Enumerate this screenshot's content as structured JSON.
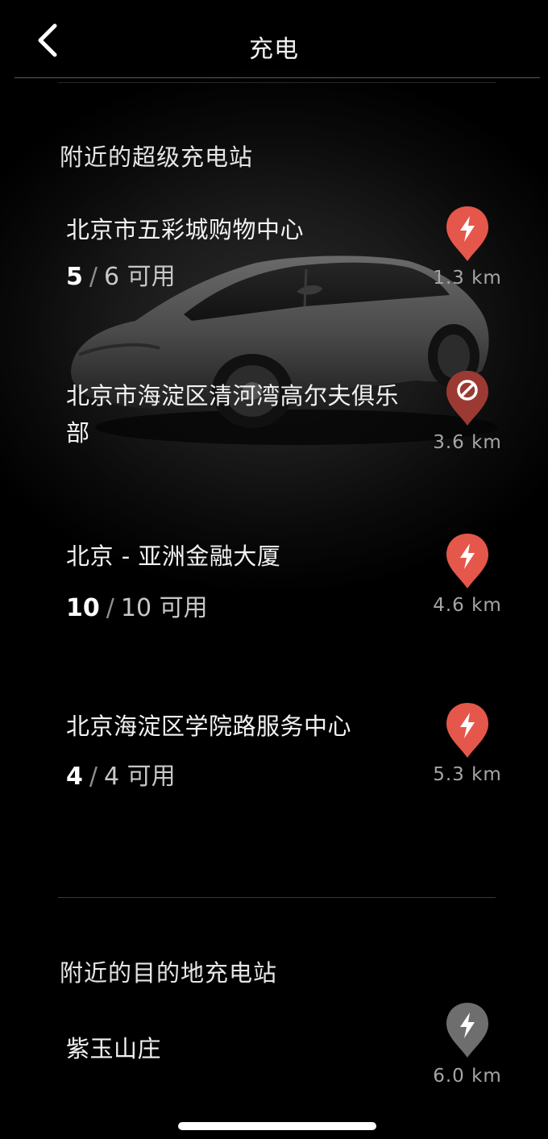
{
  "header": {
    "title": "充电",
    "back_icon": "chevron-left-icon"
  },
  "superchargers": {
    "title": "附近的超级充电站",
    "stations": [
      {
        "name": "北京市五彩城购物中心",
        "available": "5",
        "separator": "/",
        "total": "6",
        "unit": "可用",
        "distance": "1.3 km",
        "status": "available",
        "icon": "bolt-pin-icon",
        "color": "#e5574a"
      },
      {
        "name": "北京市海淀区清河湾高尔夫俱乐部",
        "distance": "3.6 km",
        "status": "unavailable",
        "icon": "no-entry-pin-icon",
        "color": "#9b3a33"
      },
      {
        "name": "北京 - 亚洲金融大厦",
        "available": "10",
        "separator": "/",
        "total": "10",
        "unit": "可用",
        "distance": "4.6 km",
        "status": "available",
        "icon": "bolt-pin-icon",
        "color": "#e5574a"
      },
      {
        "name": "北京海淀区学院路服务中心",
        "available": "4",
        "separator": "/",
        "total": "4",
        "unit": "可用",
        "distance": "5.3 km",
        "status": "available",
        "icon": "bolt-pin-icon",
        "color": "#e5574a"
      }
    ]
  },
  "destination": {
    "title": "附近的目的地充电站",
    "stations": [
      {
        "name": "紫玉山庄",
        "distance": "6.0 km",
        "status": "destination",
        "icon": "bolt-pin-icon",
        "color": "#6e6e6e"
      }
    ]
  },
  "car_image": "car-silhouette-image"
}
